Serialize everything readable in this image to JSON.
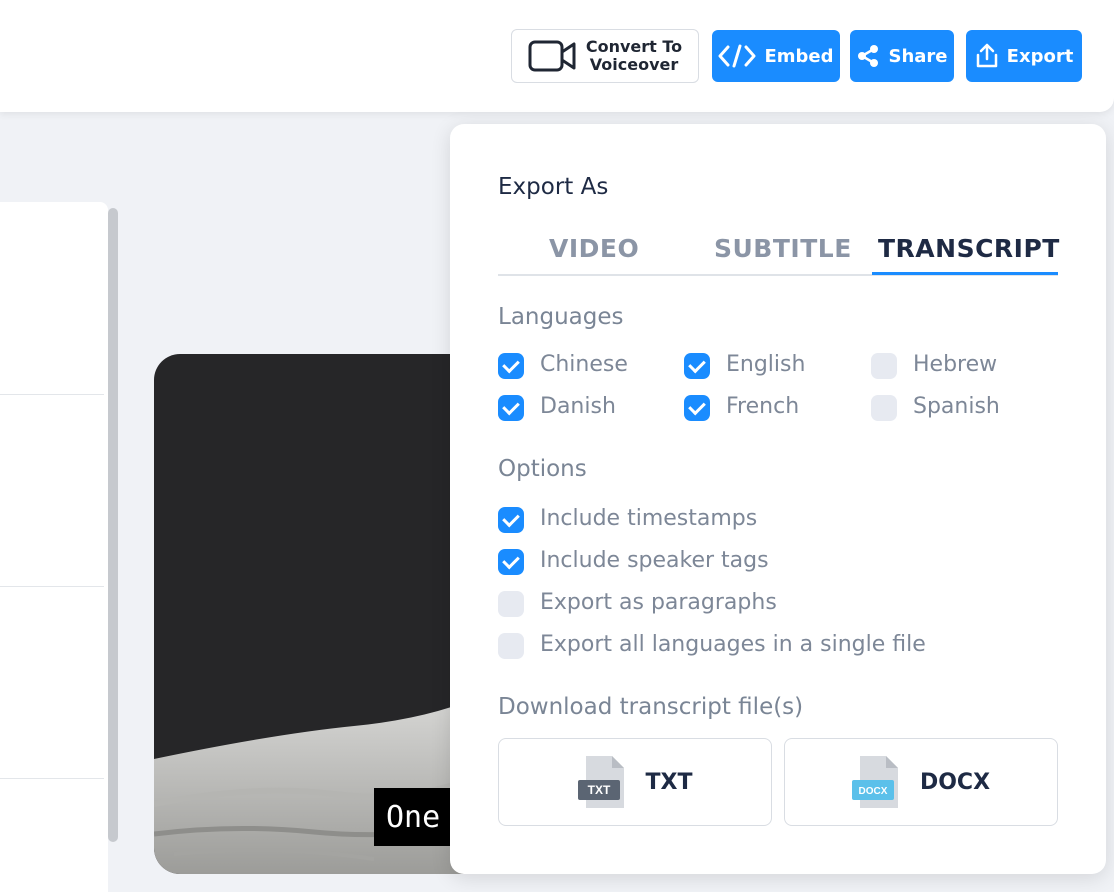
{
  "toolbar": {
    "convert_line1": "Convert To",
    "convert_line2": "Voiceover",
    "embed_label": "Embed",
    "share_label": "Share",
    "export_label": "Export"
  },
  "video": {
    "caption": "One"
  },
  "export_panel": {
    "title": "Export As",
    "tabs": [
      {
        "label": "VIDEO",
        "active": false
      },
      {
        "label": "SUBTITLE",
        "active": false
      },
      {
        "label": "TRANSCRIPT",
        "active": true
      }
    ],
    "languages_label": "Languages",
    "languages": [
      {
        "label": "Chinese",
        "checked": true
      },
      {
        "label": "English",
        "checked": true
      },
      {
        "label": "Hebrew",
        "checked": false
      },
      {
        "label": "Danish",
        "checked": true
      },
      {
        "label": "French",
        "checked": true
      },
      {
        "label": "Spanish",
        "checked": false
      }
    ],
    "options_label": "Options",
    "options": [
      {
        "label": "Include timestamps",
        "checked": true
      },
      {
        "label": "Include speaker tags",
        "checked": true
      },
      {
        "label": "Export as paragraphs",
        "checked": false
      },
      {
        "label": "Export all languages in a single file",
        "checked": false
      }
    ],
    "download_label": "Download transcript file(s)",
    "downloads": [
      {
        "label": "TXT",
        "icon_text": "TXT",
        "icon": "txt-file-icon"
      },
      {
        "label": "DOCX",
        "icon_text": "DOCX",
        "icon": "docx-file-icon"
      }
    ]
  },
  "colors": {
    "accent": "#1a8cff",
    "heading": "#1e2a44",
    "muted": "#7d8797"
  }
}
